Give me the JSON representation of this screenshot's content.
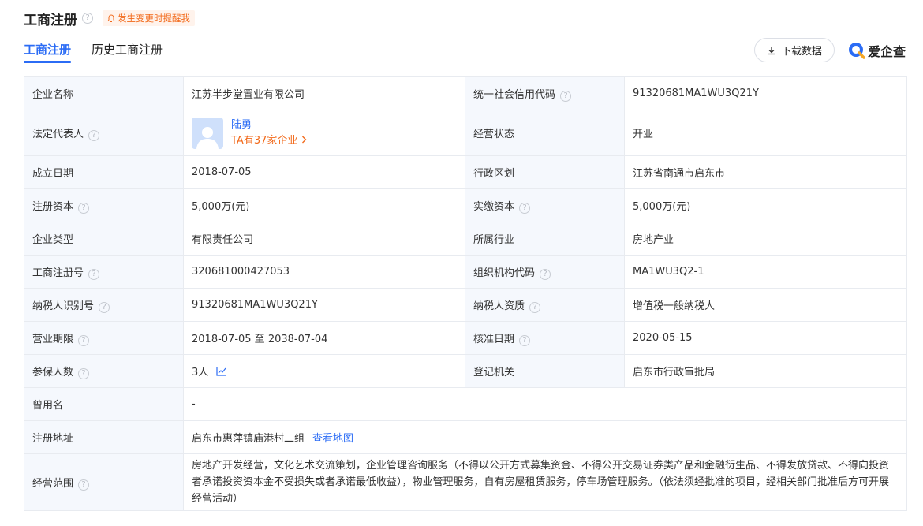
{
  "header": {
    "title": "工商注册",
    "notify_label": "发生变更时提醒我"
  },
  "tabs": [
    {
      "label": "工商注册",
      "active": true
    },
    {
      "label": "历史工商注册",
      "active": false
    }
  ],
  "toolbar": {
    "download_label": "下载数据",
    "brand": "爱企查"
  },
  "table": {
    "company_name": {
      "label": "企业名称",
      "value": "江苏半步堂置业有限公司"
    },
    "credit_code": {
      "label": "统一社会信用代码",
      "value": "91320681MA1WU3Q21Y"
    },
    "legal_rep": {
      "label": "法定代表人",
      "name": "陆勇",
      "link": "TA有37家企业"
    },
    "status": {
      "label": "经营状态",
      "value": "开业"
    },
    "founded": {
      "label": "成立日期",
      "value": "2018-07-05"
    },
    "region": {
      "label": "行政区划",
      "value": "江苏省南通市启东市"
    },
    "reg_capital": {
      "label": "注册资本",
      "value": "5,000万(元)"
    },
    "paid_capital": {
      "label": "实缴资本",
      "value": "5,000万(元)"
    },
    "company_type": {
      "label": "企业类型",
      "value": "有限责任公司"
    },
    "industry": {
      "label": "所属行业",
      "value": "房地产业"
    },
    "reg_no": {
      "label": "工商注册号",
      "value": "320681000427053"
    },
    "org_code": {
      "label": "组织机构代码",
      "value": "MA1WU3Q2-1"
    },
    "taxpayer_id": {
      "label": "纳税人识别号",
      "value": "91320681MA1WU3Q21Y"
    },
    "taxpayer_qual": {
      "label": "纳税人资质",
      "value": "增值税一般纳税人"
    },
    "term": {
      "label": "营业期限",
      "value": "2018-07-05 至 2038-07-04"
    },
    "approval_date": {
      "label": "核准日期",
      "value": "2020-05-15"
    },
    "insured": {
      "label": "参保人数",
      "value": "3人"
    },
    "authority": {
      "label": "登记机关",
      "value": "启东市行政审批局"
    },
    "former_name": {
      "label": "曾用名",
      "value": "-"
    },
    "address": {
      "label": "注册地址",
      "value": "启东市惠萍镇庙港村二组",
      "map_link": "查看地图"
    },
    "scope": {
      "label": "经营范围",
      "value": "房地产开发经营，文化艺术交流策划，企业管理咨询服务（不得以公开方式募集资金、不得公开交易证券类产品和金融衍生品、不得发放贷款、不得向投资者承诺投资资本金不受损失或者承诺最低收益），物业管理服务，自有房屋租赁服务，停车场管理服务。（依法须经批准的项目，经相关部门批准后方可开展经营活动）"
    }
  },
  "colors": {
    "accent": "#2b6cf5",
    "warn": "#f26a1b",
    "label_bg": "#f5f8fd",
    "border": "#e8ebf0"
  }
}
